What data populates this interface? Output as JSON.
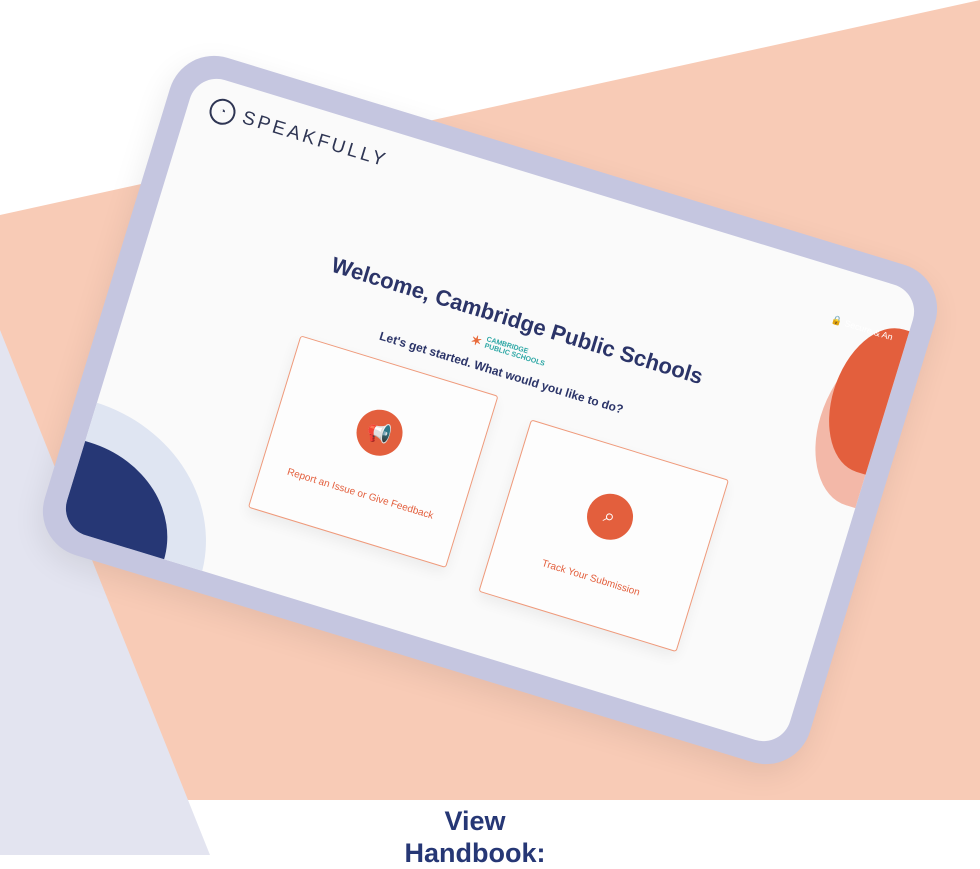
{
  "brand": {
    "name": "SPEAKFULLY"
  },
  "welcome": {
    "title": "Welcome, Cambridge Public Schools"
  },
  "partner": {
    "name": "CAMBRIDGE",
    "subtitle": "PUBLIC SCHOOLS"
  },
  "prompt": {
    "text": "Let's get started. What would you like to do?"
  },
  "options": [
    {
      "label": "Report an Issue or Give Feedback",
      "icon": "megaphone-icon"
    },
    {
      "label": "Track Your Submission",
      "icon": "search-icon"
    }
  ],
  "secure": {
    "text": "Secure & An"
  },
  "cta": {
    "label": "View Handbook:"
  },
  "colors": {
    "peach": "#f8cbb6",
    "lavender": "#e3e4f0",
    "tablet_frame": "#c5c6e0",
    "accent": "#e35f3d",
    "navy": "#263775"
  }
}
